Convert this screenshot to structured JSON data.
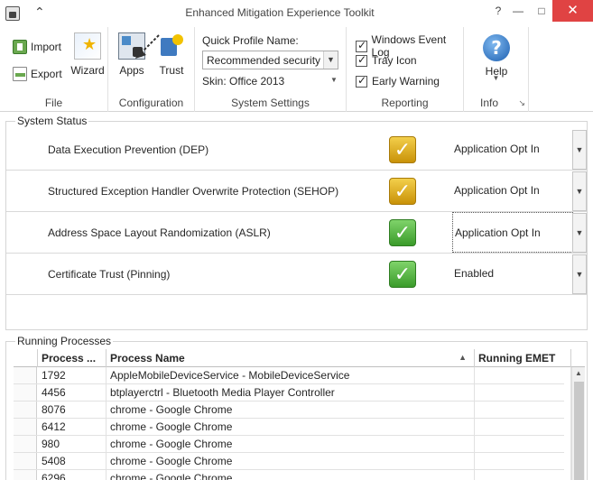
{
  "window": {
    "title": "Enhanced Mitigation Experience Toolkit",
    "help_glyph": "?",
    "min_glyph": "—",
    "max_glyph": "□",
    "close_glyph": "✕"
  },
  "ribbon": {
    "groups": {
      "file": "File",
      "configuration": "Configuration",
      "system_settings": "System Settings",
      "reporting": "Reporting",
      "info": "Info"
    },
    "buttons": {
      "import": "Import",
      "export": "Export",
      "wizard": "Wizard",
      "apps": "Apps",
      "trust": "Trust",
      "help": "Help"
    },
    "quick_profile_label": "Quick Profile Name:",
    "quick_profile_value": "Recommended security …",
    "skin_label": "Skin: Office 2013",
    "reporting": [
      {
        "label": "Windows Event Log",
        "checked": true
      },
      {
        "label": "Tray Icon",
        "checked": true
      },
      {
        "label": "Early Warning",
        "checked": true
      }
    ]
  },
  "system_status": {
    "title": "System Status",
    "rows": [
      {
        "name": "Data Execution Prevention (DEP)",
        "status": "warning",
        "value": "Application Opt In"
      },
      {
        "name": "Structured Exception Handler Overwrite Protection (SEHOP)",
        "status": "warning",
        "value": "Application Opt In"
      },
      {
        "name": "Address Space Layout Randomization (ASLR)",
        "status": "ok",
        "value": "Application Opt In"
      },
      {
        "name": "Certificate Trust (Pinning)",
        "status": "ok",
        "value": "Enabled"
      }
    ],
    "colors": {
      "warning": "#e2b21f",
      "ok": "#4fb33b"
    }
  },
  "processes": {
    "title": "Running Processes",
    "columns": [
      "Process ...",
      "Process Name",
      "Running EMET"
    ],
    "rows": [
      [
        "1792",
        "AppleMobileDeviceService - MobileDeviceService",
        ""
      ],
      [
        "4456",
        "btplayerctrl - Bluetooth Media Player Controller",
        ""
      ],
      [
        "8076",
        "chrome - Google Chrome",
        ""
      ],
      [
        "6412",
        "chrome - Google Chrome",
        ""
      ],
      [
        "980",
        "chrome - Google Chrome",
        ""
      ],
      [
        "5408",
        "chrome - Google Chrome",
        ""
      ],
      [
        "6296",
        "chrome - Google Chrome",
        ""
      ]
    ]
  }
}
